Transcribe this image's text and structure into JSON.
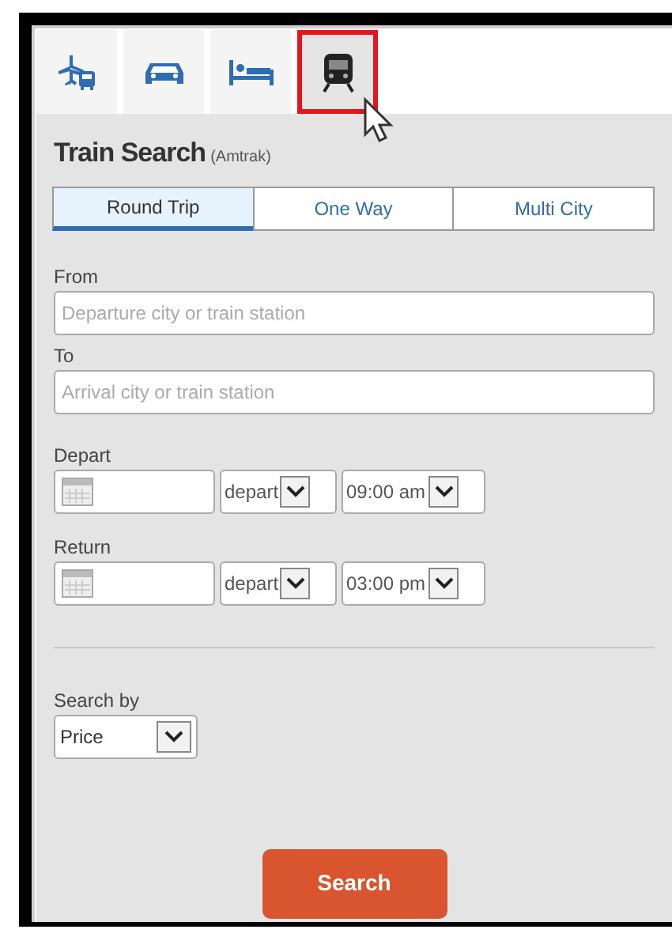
{
  "tabs": [
    {
      "kind": "flight-bus",
      "selected": false
    },
    {
      "kind": "car",
      "selected": false
    },
    {
      "kind": "bed",
      "selected": false
    },
    {
      "kind": "train",
      "selected": true
    }
  ],
  "title": "Train Search",
  "subtitle": "(Amtrak)",
  "trip_types": [
    {
      "label": "Round Trip",
      "selected": true
    },
    {
      "label": "One Way",
      "selected": false
    },
    {
      "label": "Multi City",
      "selected": false
    }
  ],
  "from": {
    "label": "From",
    "placeholder": "Departure city or train station"
  },
  "to": {
    "label": "To",
    "placeholder": "Arrival city or train station"
  },
  "dates": [
    {
      "label": "Depart",
      "mode": "depart",
      "time": "09:00 am"
    },
    {
      "label": "Return",
      "mode": "depart",
      "time": "03:00 pm"
    }
  ],
  "search_by": {
    "label": "Search by",
    "value": "Price"
  },
  "search_button": "Search"
}
